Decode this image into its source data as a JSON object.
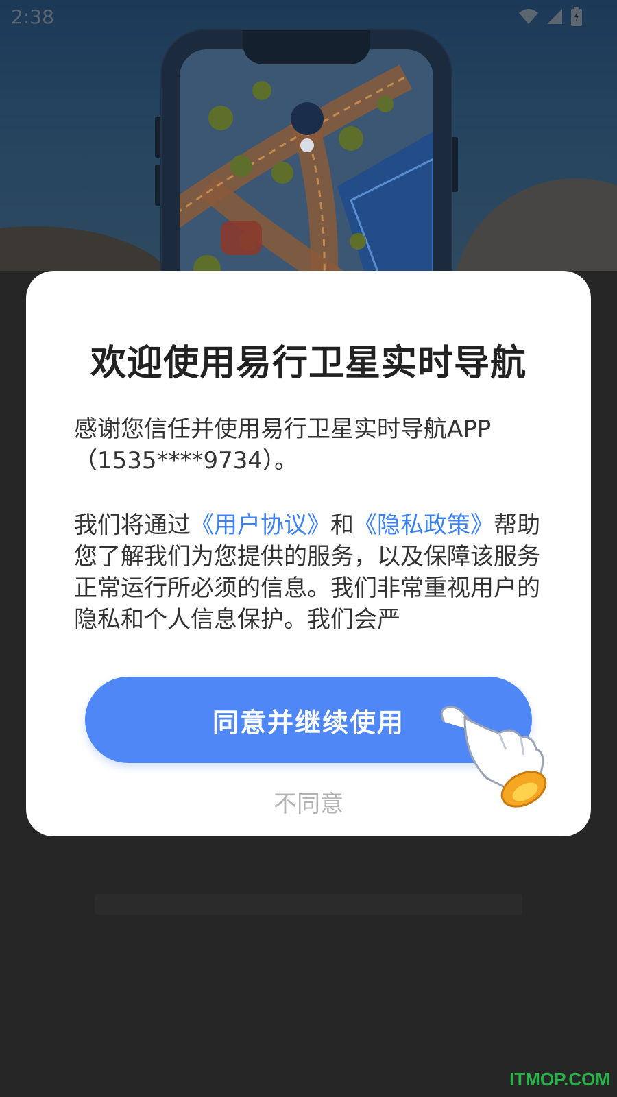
{
  "status_bar": {
    "time": "2:38",
    "icons": [
      "wifi-icon",
      "signal-icon",
      "battery-icon"
    ]
  },
  "dialog": {
    "title": "欢迎使用易行卫星实时导航",
    "para1": "感谢您信任并使用易行卫星实时导航APP（1535****9734）。",
    "para2_prefix": "我们将通过",
    "link_user_agreement": "《用户协议》",
    "para2_middle": "和",
    "link_privacy_policy": "《隐私政策》",
    "para2_suffix": "帮助您了解我们为您提供的服务，以及保障该服务正常运行所必须的信息。我们非常重视用户的隐私和个人信息保护。我们会严",
    "agree_button": "同意并继续使用",
    "disagree_button": "不同意"
  },
  "watermark": "ITMOP.COM",
  "colors": {
    "primary": "#4f88f6",
    "link": "#3d82f2",
    "overlay": "#262626",
    "watermark": "#29b24a"
  }
}
